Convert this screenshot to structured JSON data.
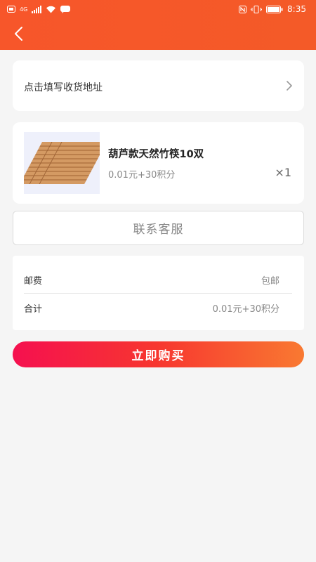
{
  "status_bar": {
    "network": "4G",
    "time": "8:35"
  },
  "header": {
    "back_icon": "chevron-left-icon"
  },
  "address": {
    "placeholder": "点击填写收货地址",
    "arrow_icon": "chevron-right-icon"
  },
  "product": {
    "name": "葫芦款天然竹筷10双",
    "price": "0.01元+30积分",
    "quantity": "×1"
  },
  "service": {
    "label": "联系客服"
  },
  "summary": {
    "shipping_label": "邮费",
    "shipping_value": "包邮",
    "total_label": "合计",
    "total_value": "0.01元+30积分"
  },
  "buy_button": {
    "label": "立即购买"
  },
  "colors": {
    "header": "#f7562a",
    "buy_gradient_start": "#f5104f",
    "buy_gradient_end": "#f97931"
  }
}
